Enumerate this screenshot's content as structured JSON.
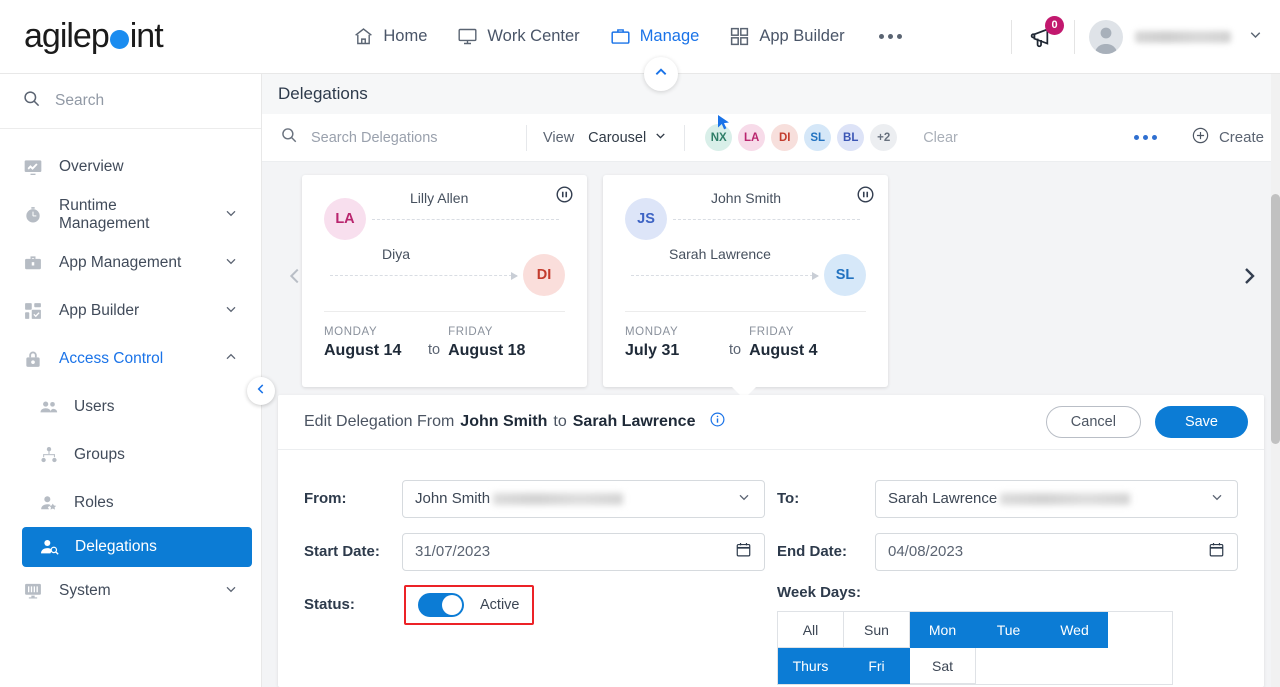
{
  "header": {
    "logo_text_a": "agilep",
    "logo_text_b": "int",
    "nav": [
      {
        "label": "Home",
        "icon": "home-icon",
        "active": false
      },
      {
        "label": "Work Center",
        "icon": "monitor-icon",
        "active": false
      },
      {
        "label": "Manage",
        "icon": "briefcase-icon",
        "active": true
      },
      {
        "label": "App Builder",
        "icon": "grid-icon",
        "active": false
      }
    ],
    "more_label": "more-menu",
    "notification_count": "0",
    "notification_icon": "megaphone-icon",
    "user_name": "",
    "accent": "#1a73e8",
    "badge_color": "#c2186e"
  },
  "sidebar": {
    "search_placeholder": "Search",
    "items": [
      {
        "label": "Overview",
        "icon": "overview-chart-icon",
        "expandable": false,
        "state": "normal"
      },
      {
        "label": "Runtime Management",
        "icon": "clock-icon",
        "expandable": true,
        "state": "normal"
      },
      {
        "label": "App Management",
        "icon": "briefcase-icon",
        "expandable": true,
        "state": "normal"
      },
      {
        "label": "App Builder",
        "icon": "grid-check-icon",
        "expandable": true,
        "state": "normal"
      },
      {
        "label": "Access Control",
        "icon": "lock-icon",
        "expandable": true,
        "state": "expanded"
      },
      {
        "label": "Users",
        "icon": "users-icon",
        "expandable": false,
        "state": "child"
      },
      {
        "label": "Groups",
        "icon": "group-tree-icon",
        "expandable": false,
        "state": "child"
      },
      {
        "label": "Roles",
        "icon": "role-user-icon",
        "expandable": false,
        "state": "child"
      },
      {
        "label": "Delegations",
        "icon": "delegation-user-icon",
        "expandable": false,
        "state": "selected"
      },
      {
        "label": "System",
        "icon": "system-monitor-icon",
        "expandable": true,
        "state": "normal"
      }
    ],
    "collapse_icon": "chevron-left-icon"
  },
  "main": {
    "page_title": "Delegations",
    "panel_collapse_icon": "chevron-up-icon",
    "toolbar": {
      "search_placeholder": "Search Delegations",
      "view_label": "View",
      "view_value": "Carousel",
      "clear_label": "Clear",
      "create_label": "Create",
      "more_label": "more-options",
      "chips": [
        {
          "initials": "NX",
          "bg": "#d9efe9",
          "fg": "#2f7e68"
        },
        {
          "initials": "LA",
          "bg": "#f7dbe9",
          "fg": "#b9256e"
        },
        {
          "initials": "DI",
          "bg": "#f7dfdc",
          "fg": "#c33c2e"
        },
        {
          "initials": "SL",
          "bg": "#d5e7f8",
          "fg": "#2272c0"
        },
        {
          "initials": "BL",
          "bg": "#dde3f7",
          "fg": "#3b55b5"
        },
        {
          "initials": "+2",
          "bg": "#eceef1",
          "fg": "#69727f"
        }
      ]
    },
    "carousel": {
      "prev_icon": "chevron-left-icon",
      "next_icon": "chevron-right-icon",
      "to_label": "to",
      "cards": [
        {
          "from_name": "Lilly Allen",
          "from_initials": "LA",
          "from_bg": "#f8dfee",
          "from_fg": "#b9256e",
          "to_name": "Diya",
          "to_initials": "DI",
          "to_bg": "#fadedb",
          "to_fg": "#c33c2e",
          "start_dow": "MONDAY",
          "start_date": "August 14",
          "end_dow": "FRIDAY",
          "end_date": "August 18",
          "pause_icon": "pause-circle-icon",
          "selected": false
        },
        {
          "from_name": "John Smith",
          "from_initials": "JS",
          "from_bg": "#dde5f8",
          "from_fg": "#3d63c4",
          "to_name": "Sarah Lawrence",
          "to_initials": "SL",
          "to_bg": "#d6e8f9",
          "to_fg": "#2272c0",
          "start_dow": "MONDAY",
          "start_date": "July 31",
          "end_dow": "FRIDAY",
          "end_date": "August 4",
          "pause_icon": "pause-circle-icon",
          "selected": true
        }
      ]
    },
    "edit_panel": {
      "title_prefix": "Edit Delegation From",
      "title_from": "John Smith",
      "title_mid": "to",
      "title_to": "Sarah Lawrence",
      "info_icon": "info-circle-icon",
      "cancel_label": "Cancel",
      "save_label": "Save",
      "from_label": "From:",
      "from_value": "John Smith",
      "to_label": "To:",
      "to_value": "Sarah Lawrence",
      "start_date_label": "Start Date:",
      "start_date_value": "31/07/2023",
      "end_date_label": "End Date:",
      "end_date_value": "04/08/2023",
      "status_label": "Status:",
      "status_value": "Active",
      "status_on": true,
      "highlight_color": "#ec2227",
      "week_days_label": "Week Days:",
      "week_days": [
        {
          "label": "All",
          "on": false
        },
        {
          "label": "Sun",
          "on": false
        },
        {
          "label": "Mon",
          "on": true
        },
        {
          "label": "Tue",
          "on": true
        },
        {
          "label": "Wed",
          "on": true
        },
        {
          "label": "Thurs",
          "on": true
        },
        {
          "label": "Fri",
          "on": true
        },
        {
          "label": "Sat",
          "on": false
        }
      ]
    }
  }
}
